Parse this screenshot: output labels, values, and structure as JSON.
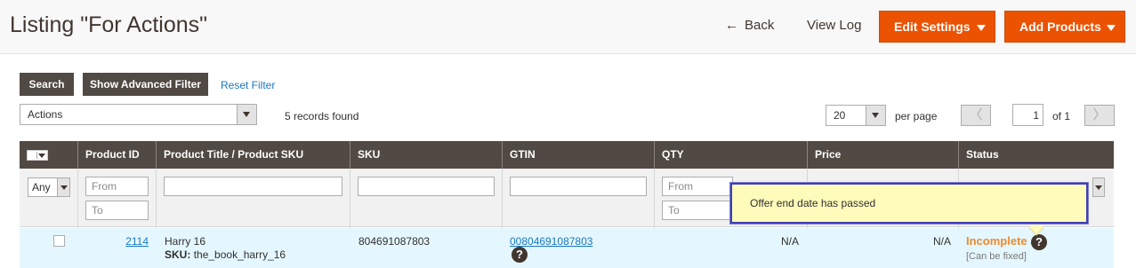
{
  "header": {
    "title": "Listing \"For Actions\"",
    "back_arrow": "←",
    "back_label": "Back",
    "view_log_label": "View Log",
    "edit_settings_label": "Edit Settings",
    "add_products_label": "Add Products"
  },
  "toolbar": {
    "search_label": "Search",
    "advanced_filter_label": "Show Advanced Filter",
    "reset_filter_label": "Reset Filter",
    "actions_selected": "Actions",
    "records_found": "5 records found",
    "per_page_value": "20",
    "per_page_label": "per page",
    "prev_symbol": "〈",
    "next_symbol": "〉",
    "current_page": "1",
    "of_pages": "of 1"
  },
  "table": {
    "columns": [
      "Product ID",
      "Product Title / Product SKU",
      "SKU",
      "GTIN",
      "QTY",
      "Price",
      "Status"
    ],
    "filters": {
      "massaction_any": "Any",
      "product_id_from": "From",
      "product_id_to": "To",
      "qty_from": "From",
      "qty_to": "To"
    },
    "rows": [
      {
        "product_id": "2114",
        "title": "Harry 16",
        "sku_label": "SKU:",
        "sku_value": "the_book_harry_16",
        "sku": "804691087803",
        "gtin": "00804691087803",
        "qty": "N/A",
        "price": "N/A",
        "status": "Incomplete",
        "status_note": "[Can be fixed]"
      }
    ]
  },
  "tooltip": {
    "text": "Offer end date has passed"
  },
  "icons": {
    "help": "?"
  },
  "colors": {
    "accent": "#eb5202",
    "header_bg": "#514943",
    "status_incomplete": "#eb8b2f",
    "link": "#1979c3",
    "tooltip_bg": "#fffbbb",
    "tooltip_border": "#3e3fb5"
  }
}
